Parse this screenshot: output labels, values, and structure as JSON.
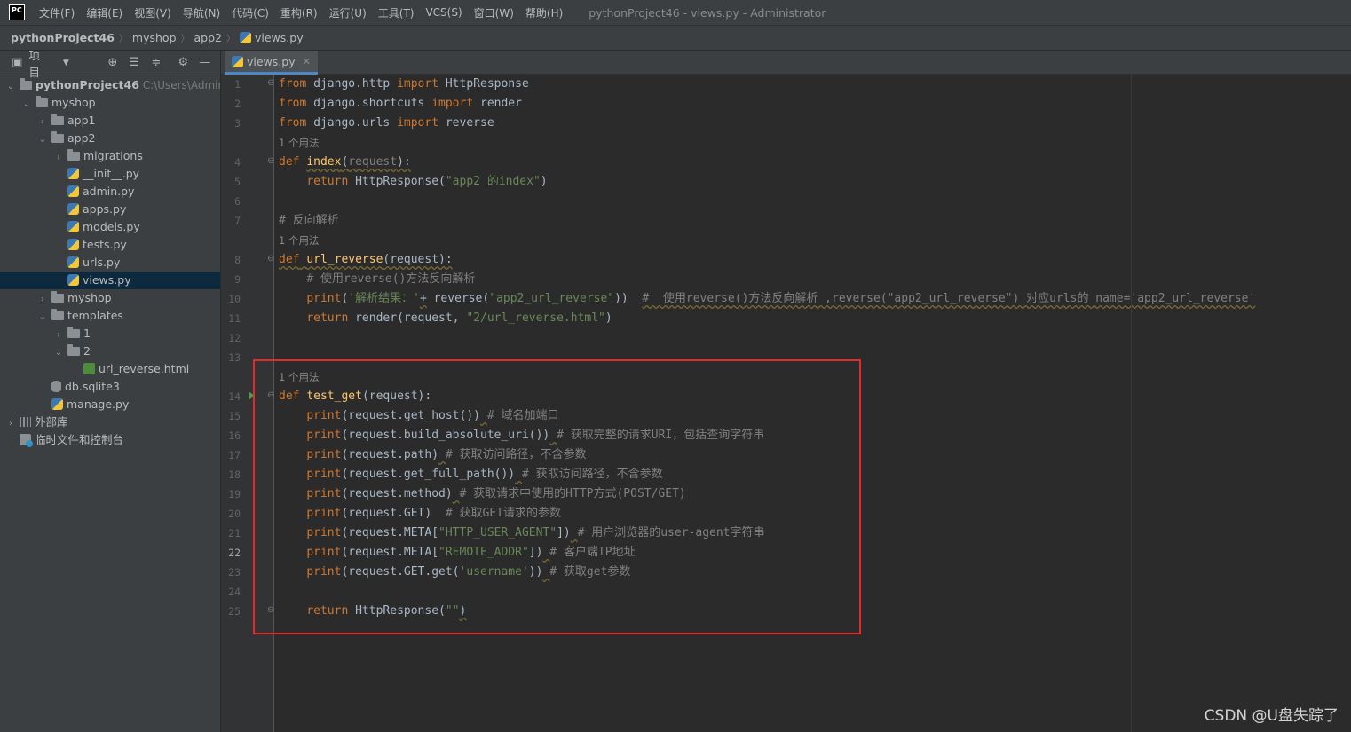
{
  "menu": {
    "items": [
      "文件(F)",
      "编辑(E)",
      "视图(V)",
      "导航(N)",
      "代码(C)",
      "重构(R)",
      "运行(U)",
      "工具(T)",
      "VCS(S)",
      "窗口(W)",
      "帮助(H)"
    ],
    "window_title": "pythonProject46 - views.py - Administrator"
  },
  "breadcrumb": [
    "pythonProject46",
    "myshop",
    "app2",
    "views.py"
  ],
  "sidebar": {
    "panel_label": "项目",
    "tree": [
      {
        "label": "pythonProject46",
        "extra": "C:\\Users\\Adminis",
        "type": "folder",
        "expanded": true
      },
      {
        "label": "myshop",
        "type": "folder",
        "expanded": true
      },
      {
        "label": "app1",
        "type": "folder",
        "expanded": false
      },
      {
        "label": "app2",
        "type": "folder",
        "expanded": true
      },
      {
        "label": "migrations",
        "type": "folder",
        "expanded": false
      },
      {
        "label": "__init__.py",
        "type": "py"
      },
      {
        "label": "admin.py",
        "type": "py"
      },
      {
        "label": "apps.py",
        "type": "py"
      },
      {
        "label": "models.py",
        "type": "py"
      },
      {
        "label": "tests.py",
        "type": "py"
      },
      {
        "label": "urls.py",
        "type": "py"
      },
      {
        "label": "views.py",
        "type": "py",
        "selected": true
      },
      {
        "label": "myshop",
        "type": "folder",
        "expanded": false
      },
      {
        "label": "templates",
        "type": "folder",
        "expanded": true
      },
      {
        "label": "1",
        "type": "folder",
        "expanded": false
      },
      {
        "label": "2",
        "type": "folder",
        "expanded": true
      },
      {
        "label": "url_reverse.html",
        "type": "html"
      },
      {
        "label": "db.sqlite3",
        "type": "db"
      },
      {
        "label": "manage.py",
        "type": "py"
      },
      {
        "label": "外部库",
        "type": "lib",
        "expanded": false
      },
      {
        "label": "临时文件和控制台",
        "type": "scratch"
      }
    ]
  },
  "editor": {
    "tab_label": "views.py",
    "usage_hint": "1 个用法",
    "current_line": 22,
    "line_numbers": [
      "1",
      "2",
      "3",
      "4",
      "5",
      "6",
      "7",
      "8",
      "9",
      "10",
      "11",
      "12",
      "13",
      "14",
      "15",
      "16",
      "17",
      "18",
      "19",
      "20",
      "21",
      "22",
      "23",
      "24",
      "25"
    ]
  },
  "watermark": "CSDN @U盘失踪了",
  "colors": {
    "keyword": "#cc7832",
    "function": "#ffc66d",
    "string": "#6a8759",
    "comment": "#808080",
    "highlight_box": "#e12c2c"
  }
}
